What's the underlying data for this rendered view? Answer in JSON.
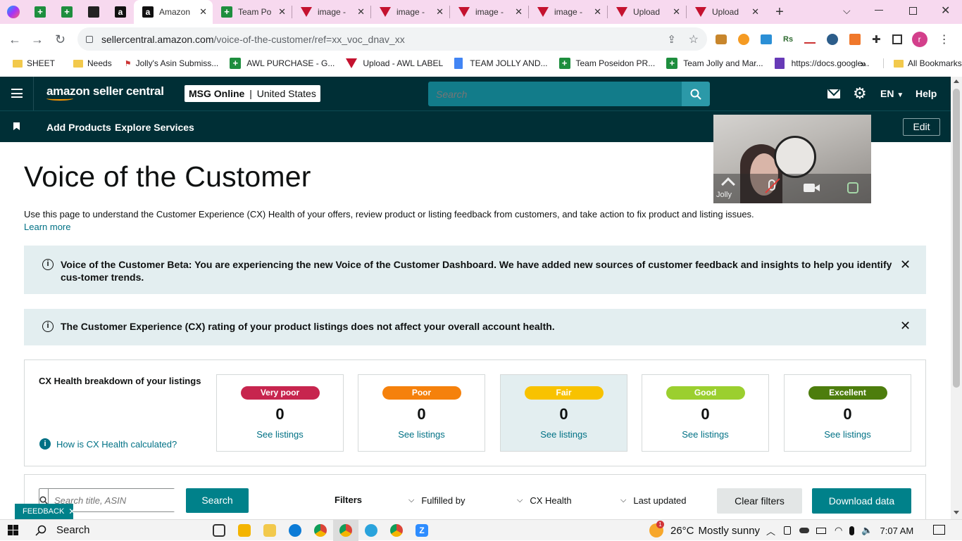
{
  "browser": {
    "tabs": [
      {
        "label": "Amazon",
        "active": true
      },
      {
        "label": "Team Po"
      },
      {
        "label": "image -"
      },
      {
        "label": "image -"
      },
      {
        "label": "image -"
      },
      {
        "label": "image -"
      },
      {
        "label": "Upload"
      },
      {
        "label": "Upload"
      }
    ],
    "url_host": "sellercentral.amazon.com",
    "url_path": "/voice-of-the-customer/ref=xx_voc_dnav_xx",
    "bookmarks": [
      {
        "label": "SHEET",
        "icon": "folder-icon"
      },
      {
        "label": "Needs",
        "icon": "folder-icon"
      },
      {
        "label": "Jolly's Asin Submiss...",
        "icon": "flag-icon"
      },
      {
        "label": "AWL PURCHASE - G...",
        "icon": "sheets-icon"
      },
      {
        "label": "Upload - AWL LABEL",
        "icon": "brand-v-icon"
      },
      {
        "label": "TEAM JOLLY AND...",
        "icon": "docs-icon"
      },
      {
        "label": "Team Poseidon PR...",
        "icon": "sheets-icon"
      },
      {
        "label": "Team Jolly and Mar...",
        "icon": "sheets-icon"
      },
      {
        "label": "https://docs.google...",
        "icon": "forms-icon"
      }
    ],
    "all_bookmarks": "All Bookmarks",
    "more_bookmarks": "»"
  },
  "header": {
    "logo_line1": "amazon seller central",
    "store_name": "MSG Online",
    "store_region": "United States",
    "search_placeholder": "Search",
    "language": "EN",
    "help": "Help"
  },
  "subnav": {
    "items": [
      "Add Products",
      "Explore Services"
    ],
    "edit": "Edit"
  },
  "video": {
    "name": "Jolly"
  },
  "page": {
    "title": "Voice of the Customer",
    "description": "Use this page to understand the Customer Experience (CX) Health of your offers, review product or listing feedback from customers, and take action to fix product and listing issues.",
    "learn_more": "Learn more",
    "banner1": "Voice of the Customer Beta: You are experiencing the new Voice of the Customer Dashboard. We have added new sources of customer feedback and insights to help you identify cus-tomer trends.",
    "banner2": "The Customer Experience (CX) rating of your product listings does not affect your overall account health."
  },
  "cx": {
    "heading": "CX Health breakdown of your listings",
    "how_link": "How is CX Health calculated?",
    "cards": [
      {
        "label": "Very poor",
        "count": "0",
        "link": "See listings",
        "color": "#c7254e"
      },
      {
        "label": "Poor",
        "count": "0",
        "link": "See listings",
        "color": "#f5810c"
      },
      {
        "label": "Fair",
        "count": "0",
        "link": "See listings",
        "color": "#f8c200"
      },
      {
        "label": "Good",
        "count": "0",
        "link": "See listings",
        "color": "#9bcf2f"
      },
      {
        "label": "Excellent",
        "count": "0",
        "link": "See listings",
        "color": "#4d7d0d"
      }
    ]
  },
  "filters": {
    "search_placeholder": "Search title, ASIN",
    "search_button": "Search",
    "filters_label": "Filters",
    "fulfilled_by": "Fulfilled by",
    "cx_health": "CX Health",
    "last_updated": "Last updated",
    "clear": "Clear filters",
    "download": "Download data"
  },
  "feedback": "FEEDBACK",
  "taskbar": {
    "search": "Search",
    "weather_temp": "26°C",
    "weather_desc": "Mostly sunny",
    "time": "7:07 AM",
    "weather_badge": "1"
  }
}
